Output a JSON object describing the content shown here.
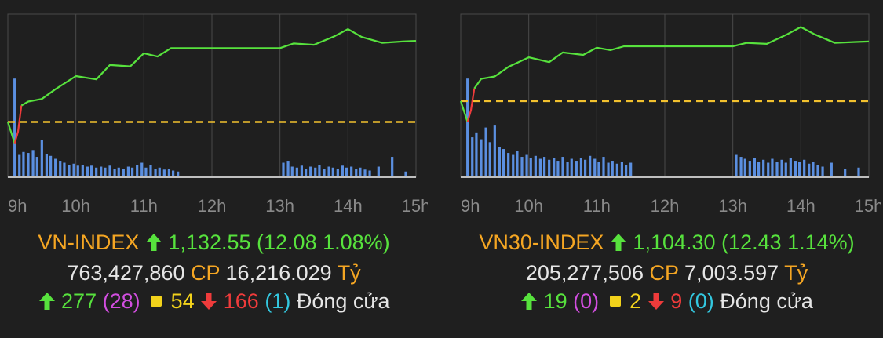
{
  "colors": {
    "background": "#1f1f1f",
    "grid": "#4a4a4a",
    "price_up": "#57e23d",
    "price_down": "#ef3b3b",
    "reference_line": "#f2c12e",
    "volume": "#5b8fe0",
    "label_orange": "#f5a623"
  },
  "chart_data": [
    {
      "type": "line",
      "index_name": "VN-INDEX",
      "x_tick_labels": [
        "9h",
        "10h",
        "11h",
        "12h",
        "13h",
        "14h",
        "15h"
      ],
      "reference_value": 1120.47,
      "ylim": [
        1112,
        1137
      ],
      "series": [
        {
          "role": "index",
          "x": [
            9.0,
            9.1,
            9.15,
            9.2,
            9.3,
            9.5,
            9.7,
            10.0,
            10.3,
            10.5,
            10.8,
            11.0,
            11.2,
            11.4,
            11.5,
            12.0,
            13.0,
            13.2,
            13.5,
            13.8,
            14.0,
            14.2,
            14.5,
            14.8,
            15.0
          ],
          "y": [
            1120.47,
            1117.2,
            1119.0,
            1123.0,
            1123.6,
            1124.0,
            1125.5,
            1127.5,
            1127.0,
            1129.2,
            1129.0,
            1131.0,
            1130.5,
            1131.8,
            1131.8,
            1131.8,
            1131.8,
            1132.5,
            1132.3,
            1133.6,
            1134.7,
            1133.5,
            1132.6,
            1132.8,
            1132.9
          ]
        }
      ],
      "volume_bars": [
        {
          "x": 9.1,
          "v": 100
        },
        {
          "x": 9.17,
          "v": 22
        },
        {
          "x": 9.23,
          "v": 25
        },
        {
          "x": 9.3,
          "v": 24
        },
        {
          "x": 9.37,
          "v": 27
        },
        {
          "x": 9.43,
          "v": 20
        },
        {
          "x": 9.5,
          "v": 37
        },
        {
          "x": 9.57,
          "v": 23
        },
        {
          "x": 9.63,
          "v": 21
        },
        {
          "x": 9.7,
          "v": 18
        },
        {
          "x": 9.77,
          "v": 16
        },
        {
          "x": 9.83,
          "v": 14
        },
        {
          "x": 9.9,
          "v": 12
        },
        {
          "x": 9.97,
          "v": 13
        },
        {
          "x": 10.03,
          "v": 11
        },
        {
          "x": 10.1,
          "v": 12
        },
        {
          "x": 10.17,
          "v": 10
        },
        {
          "x": 10.23,
          "v": 11
        },
        {
          "x": 10.3,
          "v": 9
        },
        {
          "x": 10.37,
          "v": 10
        },
        {
          "x": 10.43,
          "v": 9
        },
        {
          "x": 10.5,
          "v": 11
        },
        {
          "x": 10.57,
          "v": 8
        },
        {
          "x": 10.63,
          "v": 9
        },
        {
          "x": 10.7,
          "v": 8
        },
        {
          "x": 10.77,
          "v": 10
        },
        {
          "x": 10.83,
          "v": 9
        },
        {
          "x": 10.9,
          "v": 12
        },
        {
          "x": 10.97,
          "v": 14
        },
        {
          "x": 11.03,
          "v": 9
        },
        {
          "x": 11.1,
          "v": 12
        },
        {
          "x": 11.17,
          "v": 8
        },
        {
          "x": 11.23,
          "v": 9
        },
        {
          "x": 11.3,
          "v": 7
        },
        {
          "x": 11.37,
          "v": 8
        },
        {
          "x": 11.43,
          "v": 6
        },
        {
          "x": 11.5,
          "v": 5
        },
        {
          "x": 13.05,
          "v": 14
        },
        {
          "x": 13.12,
          "v": 16
        },
        {
          "x": 13.18,
          "v": 10
        },
        {
          "x": 13.25,
          "v": 9
        },
        {
          "x": 13.32,
          "v": 11
        },
        {
          "x": 13.38,
          "v": 8
        },
        {
          "x": 13.45,
          "v": 10
        },
        {
          "x": 13.52,
          "v": 9
        },
        {
          "x": 13.58,
          "v": 12
        },
        {
          "x": 13.65,
          "v": 8
        },
        {
          "x": 13.72,
          "v": 10
        },
        {
          "x": 13.78,
          "v": 9
        },
        {
          "x": 13.85,
          "v": 8
        },
        {
          "x": 13.92,
          "v": 11
        },
        {
          "x": 13.98,
          "v": 9
        },
        {
          "x": 14.05,
          "v": 10
        },
        {
          "x": 14.12,
          "v": 8
        },
        {
          "x": 14.18,
          "v": 9
        },
        {
          "x": 14.25,
          "v": 7
        },
        {
          "x": 14.32,
          "v": 6
        },
        {
          "x": 14.45,
          "v": 10
        },
        {
          "x": 14.65,
          "v": 20
        },
        {
          "x": 14.85,
          "v": 5
        }
      ]
    },
    {
      "type": "line",
      "index_name": "VN30-INDEX",
      "x_tick_labels": [
        "9h",
        "10h",
        "11h",
        "12h",
        "13h",
        "14h",
        "15h"
      ],
      "reference_value": 1091.87,
      "ylim": [
        1076,
        1110
      ],
      "series": [
        {
          "role": "index",
          "x": [
            9.0,
            9.1,
            9.15,
            9.2,
            9.3,
            9.5,
            9.7,
            10.0,
            10.3,
            10.5,
            10.8,
            11.0,
            11.2,
            11.4,
            11.5,
            12.0,
            13.0,
            13.2,
            13.5,
            13.8,
            14.0,
            14.2,
            14.5,
            14.8,
            15.0
          ],
          "y": [
            1091.87,
            1087.5,
            1090.0,
            1094.5,
            1096.5,
            1097.0,
            1099.0,
            1101.0,
            1100.0,
            1102.0,
            1101.5,
            1103.0,
            1102.5,
            1103.3,
            1103.3,
            1103.3,
            1103.3,
            1104.0,
            1103.8,
            1105.8,
            1107.3,
            1105.8,
            1104.0,
            1104.2,
            1104.3
          ]
        }
      ],
      "volume_bars": [
        {
          "x": 9.1,
          "v": 100
        },
        {
          "x": 9.17,
          "v": 40
        },
        {
          "x": 9.23,
          "v": 45
        },
        {
          "x": 9.3,
          "v": 38
        },
        {
          "x": 9.37,
          "v": 50
        },
        {
          "x": 9.43,
          "v": 35
        },
        {
          "x": 9.5,
          "v": 52
        },
        {
          "x": 9.57,
          "v": 30
        },
        {
          "x": 9.63,
          "v": 28
        },
        {
          "x": 9.7,
          "v": 24
        },
        {
          "x": 9.77,
          "v": 22
        },
        {
          "x": 9.83,
          "v": 26
        },
        {
          "x": 9.9,
          "v": 20
        },
        {
          "x": 9.97,
          "v": 22
        },
        {
          "x": 10.03,
          "v": 19
        },
        {
          "x": 10.1,
          "v": 21
        },
        {
          "x": 10.17,
          "v": 18
        },
        {
          "x": 10.23,
          "v": 20
        },
        {
          "x": 10.3,
          "v": 17
        },
        {
          "x": 10.37,
          "v": 19
        },
        {
          "x": 10.43,
          "v": 16
        },
        {
          "x": 10.5,
          "v": 20
        },
        {
          "x": 10.57,
          "v": 15
        },
        {
          "x": 10.63,
          "v": 18
        },
        {
          "x": 10.7,
          "v": 16
        },
        {
          "x": 10.77,
          "v": 19
        },
        {
          "x": 10.83,
          "v": 17
        },
        {
          "x": 10.9,
          "v": 21
        },
        {
          "x": 10.97,
          "v": 18
        },
        {
          "x": 11.03,
          "v": 15
        },
        {
          "x": 11.1,
          "v": 20
        },
        {
          "x": 11.17,
          "v": 14
        },
        {
          "x": 11.23,
          "v": 16
        },
        {
          "x": 11.3,
          "v": 13
        },
        {
          "x": 11.37,
          "v": 15
        },
        {
          "x": 11.43,
          "v": 12
        },
        {
          "x": 11.5,
          "v": 14
        },
        {
          "x": 13.05,
          "v": 22
        },
        {
          "x": 13.12,
          "v": 20
        },
        {
          "x": 13.18,
          "v": 18
        },
        {
          "x": 13.25,
          "v": 16
        },
        {
          "x": 13.32,
          "v": 19
        },
        {
          "x": 13.38,
          "v": 15
        },
        {
          "x": 13.45,
          "v": 17
        },
        {
          "x": 13.52,
          "v": 14
        },
        {
          "x": 13.58,
          "v": 18
        },
        {
          "x": 13.65,
          "v": 15
        },
        {
          "x": 13.72,
          "v": 17
        },
        {
          "x": 13.78,
          "v": 14
        },
        {
          "x": 13.85,
          "v": 19
        },
        {
          "x": 13.92,
          "v": 16
        },
        {
          "x": 13.98,
          "v": 15
        },
        {
          "x": 14.05,
          "v": 17
        },
        {
          "x": 14.12,
          "v": 13
        },
        {
          "x": 14.18,
          "v": 15
        },
        {
          "x": 14.25,
          "v": 12
        },
        {
          "x": 14.32,
          "v": 10
        },
        {
          "x": 14.45,
          "v": 14
        },
        {
          "x": 14.65,
          "v": 8
        },
        {
          "x": 14.85,
          "v": 9
        }
      ]
    }
  ],
  "panels": [
    {
      "name": "VN-INDEX",
      "value": "1,132.55",
      "change": "(12.08 1.08%)",
      "volume": "763,427,860",
      "cp_label": "CP",
      "turnover": "16,216.029",
      "unit": "Tỷ",
      "advancers": "277",
      "ceiling": "(28)",
      "unchanged": "54",
      "decliners": "166",
      "floor": "(1)",
      "status": "Đóng cửa"
    },
    {
      "name": "VN30-INDEX",
      "value": "1,104.30",
      "change": "(12.43 1.14%)",
      "volume": "205,277,506",
      "cp_label": "CP",
      "turnover": "7,003.597",
      "unit": "Tỷ",
      "advancers": "19",
      "ceiling": "(0)",
      "unchanged": "2",
      "decliners": "9",
      "floor": "(0)",
      "status": "Đóng cửa"
    }
  ]
}
